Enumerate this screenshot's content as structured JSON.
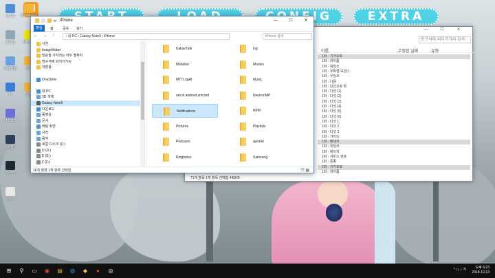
{
  "game": {
    "logo": "M",
    "start": "START",
    "load": "LOAD",
    "config": "CONFIG",
    "extra": "EXTRA"
  },
  "desktop_icons": [
    {
      "label": "내 PC",
      "color": "#4c8fd6"
    },
    {
      "label": "휴지통",
      "color": "#8fa6b4"
    },
    {
      "label": "바탕화면",
      "color": "#6aa1e1"
    },
    {
      "label": "IP",
      "color": "#3a7bd5"
    },
    {
      "label": "디스코드",
      "color": "#6c6fd8"
    },
    {
      "label": "스팀",
      "color": "#2a3f5a"
    },
    {
      "label": "Steam",
      "color": "#1b2838"
    },
    {
      "label": "txt",
      "color": "#e8e8e8"
    }
  ],
  "desktop_icons2": [
    {
      "label": "BatchFiles",
      "color": "#f3b63a"
    },
    {
      "label": "카카오톡",
      "color": "#f7e600"
    },
    {
      "label": "알씨",
      "color": "#f3b63a"
    },
    {
      "label": "꿀캠",
      "color": "#f3b63a"
    }
  ],
  "front": {
    "title": "iPhone",
    "controls": [
      "—",
      "☐",
      "✕"
    ],
    "ribbon": [
      "파일",
      "홈",
      "공유",
      "보기"
    ],
    "nav": "← → ↑",
    "breadcrumb": "›  내 PC  ›  Galaxy Note9  ›  iPhone",
    "search_placeholder": "iPhone 검색",
    "nav_items": [
      {
        "label": "사진",
        "color": "#f3c14a"
      },
      {
        "label": "ImageMaker",
        "color": "#f3c14a"
      },
      {
        "label": "망순을 가지러는 어두 펼쳐지",
        "color": "#f3c14a"
      },
      {
        "label": "방구석에 외어가가씨",
        "color": "#f3c14a"
      },
      {
        "label": "저장용",
        "color": "#f3c14a"
      },
      {
        "label": "",
        "color": "#ffffff"
      },
      {
        "label": "OneDrive",
        "color": "#3a8ee6"
      },
      {
        "label": "",
        "color": "#ffffff"
      },
      {
        "label": "내 PC",
        "color": "#4c8fd6"
      },
      {
        "label": "3D 개체",
        "color": "#6aa1e1"
      },
      {
        "label": "Galaxy Note9",
        "color": "#555555"
      },
      {
        "label": "다운로드",
        "color": "#3a8ee6"
      },
      {
        "label": "동영상",
        "color": "#6aa1e1"
      },
      {
        "label": "문서",
        "color": "#6aa1e1"
      },
      {
        "label": "바탕 화면",
        "color": "#4c8fd6"
      },
      {
        "label": "사진",
        "color": "#6aa1e1"
      },
      {
        "label": "음악",
        "color": "#6aa1e1"
      },
      {
        "label": "로컬 디스크 (C:)",
        "color": "#888888"
      },
      {
        "label": "D (D:)",
        "color": "#888888"
      },
      {
        "label": "E (E:)",
        "color": "#888888"
      },
      {
        "label": "F (F:)",
        "color": "#888888"
      }
    ],
    "folders_left": [
      "KakaoTalk",
      "Mobizen",
      "MTTLogAI",
      "net.ib.android.smcard",
      "Notifications",
      "Pictures",
      "Podcasts",
      "Ringtones"
    ],
    "folders_right": [
      "log",
      "Movies",
      "Music",
      "NeutronMP",
      "NPKI",
      "Playlists",
      "quicket",
      "Samsung"
    ],
    "selected_folder": "Notifications",
    "status": "16개 항목     1개 항목 선택함",
    "view_icons": "☷ ▦"
  },
  "back": {
    "controls": [
      "—",
      "☐",
      "✕"
    ],
    "search_placeholder": "방구석에 외어가가씨 검색",
    "col_name": "이름",
    "col_date": "수정한 날짜",
    "col_type": "유형",
    "rows": [
      "1화 - 기가오토",
      "1화 - 라이툼",
      "1화 - 워딩쓰",
      "1화 - 우박형 보관나",
      "1화 - 우딩쓰",
      "1화 - 나용",
      "1화 - 단선오토 맞",
      "1화 - 다섯 (1)",
      "1화 - 다섯 (2)",
      "1화 - 다섯 (3)",
      "1화 - 다섯 (4)",
      "1화 - 다섯 (5)",
      "1화 - 다섯 (6)",
      "1화 - 다섯 1",
      "1화 - 다섯 2",
      "1화 - 다섯 3",
      "1화 - 가이드",
      "1화 - 메세지",
      "1화 - 우딩쓰",
      "1화 - 에이치",
      "1화 - 서비스 앤프",
      "1화 - 존종",
      "1화 - 기가오토",
      "1화 - 라이툼"
    ],
    "highlight_rows": [
      0,
      17,
      22
    ],
    "status": "71개 항목  1개 항목 선택함 445KB"
  },
  "taskbar": {
    "icons": [
      "⊞",
      "⚲",
      "▭",
      "◉",
      "▤",
      "◍",
      "◆",
      "●",
      "◎"
    ],
    "time": "오후 6:23",
    "date": "2018-10-13",
    "tray": "^ ▭ ♪ 가"
  }
}
